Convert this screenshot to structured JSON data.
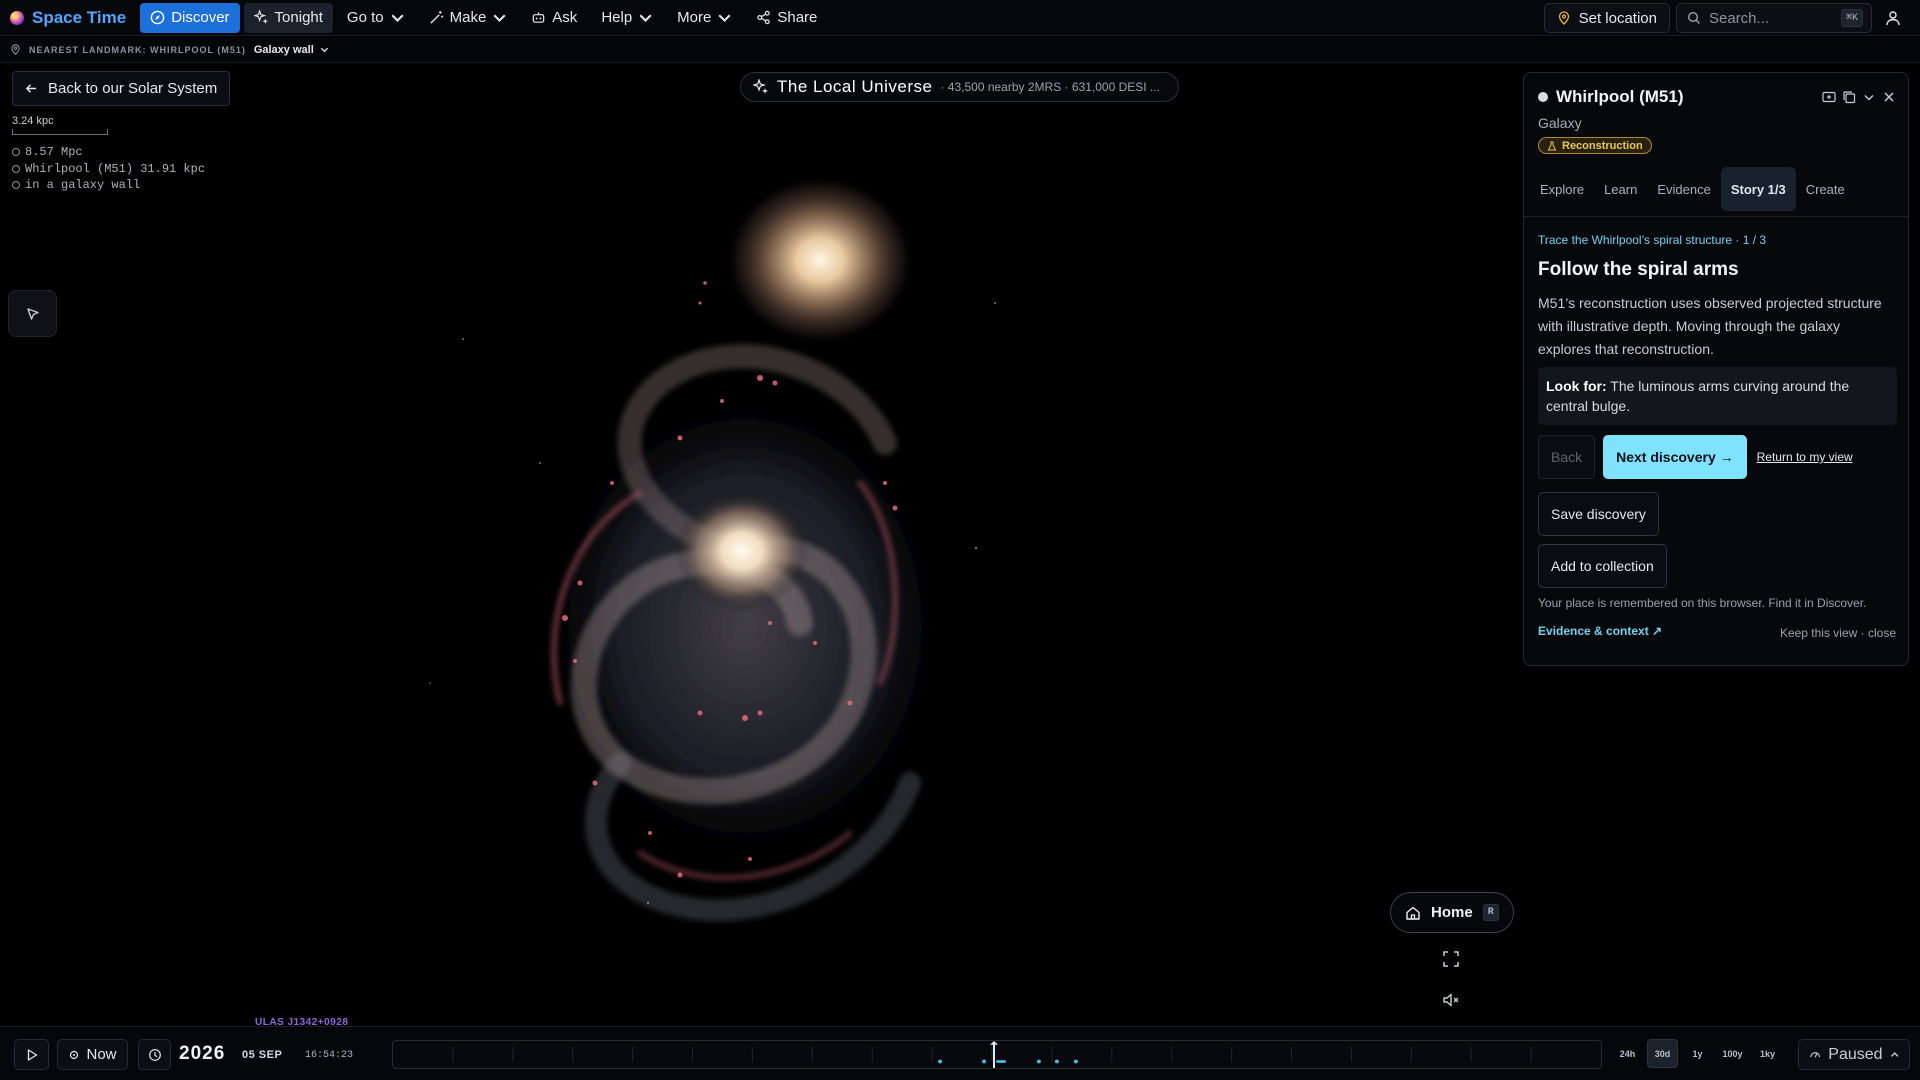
{
  "nav": {
    "brand": "Space Time",
    "items": [
      {
        "label": "Discover",
        "icon": "compass-icon"
      },
      {
        "label": "Tonight",
        "icon": "sparkle-icon"
      },
      {
        "label": "Go to",
        "icon": ""
      },
      {
        "label": "Make",
        "icon": "wand-icon"
      },
      {
        "label": "Ask",
        "icon": "robot-icon"
      },
      {
        "label": "Help",
        "icon": ""
      },
      {
        "label": "More",
        "icon": ""
      },
      {
        "label": "Share",
        "icon": "share-icon"
      }
    ],
    "set_location": "Set location",
    "search_placeholder": "Search...",
    "search_shortcut": "⌘K"
  },
  "landmark": {
    "label": "NEAREST LANDMARK: WHIRLPOOL (M51)",
    "value": "Galaxy wall"
  },
  "overlay": {
    "back_button": "Back to our Solar System",
    "scale_label": "3.24 kpc",
    "distances": [
      "8.57 Mpc",
      "Whirlpool (M51) 31.91 kpc",
      "in a galaxy wall"
    ]
  },
  "universe": {
    "title": "The Local Universe",
    "subtitle": "· 43,500 nearby 2MRS · 631,000 DESI ..."
  },
  "panel": {
    "title": "Whirlpool (M51)",
    "type": "Galaxy",
    "badge": "Reconstruction",
    "tabs": [
      "Explore",
      "Learn",
      "Evidence",
      "Story 1/3",
      "Create"
    ],
    "active_tab": "Story 1/3",
    "story_crumb": "Trace the Whirlpool’s spiral structure · 1 / 3",
    "story_title": "Follow the spiral arms",
    "story_body": "M51’s reconstruction uses observed projected structure with illustrative depth. Moving through the galaxy explores that reconstruction.",
    "lookfor_label": "Look for:",
    "lookfor_text": " The luminous arms curving around the central bulge.",
    "back_button": "Back",
    "next_button": "Next discovery →",
    "return_link": "Return to my view",
    "save_button": "Save discovery",
    "collection_button": "Add to collection",
    "remember_note": "Your place is remembered on this browser. Find it in Discover.",
    "evidence_link": "Evidence & context ↗",
    "keep_view": "Keep this view · close"
  },
  "map_controls": {
    "home_label": "Home",
    "home_shortcut": "R"
  },
  "object_label": "ULAS J1342+0928",
  "timeline": {
    "now_label": "Now",
    "year": "2026",
    "date": "05 SEP",
    "clock": "16:54:23",
    "ranges": [
      "24h",
      "30d",
      "1y",
      "100y",
      "1ky"
    ],
    "active_range": "30d",
    "status": "Paused"
  },
  "colors": {
    "accent": "#1d6fd9",
    "brand": "#4ea7ff",
    "primary_button": "#7fe3ff",
    "story_link": "#6fd3ef",
    "badge": "#e9c85a"
  }
}
